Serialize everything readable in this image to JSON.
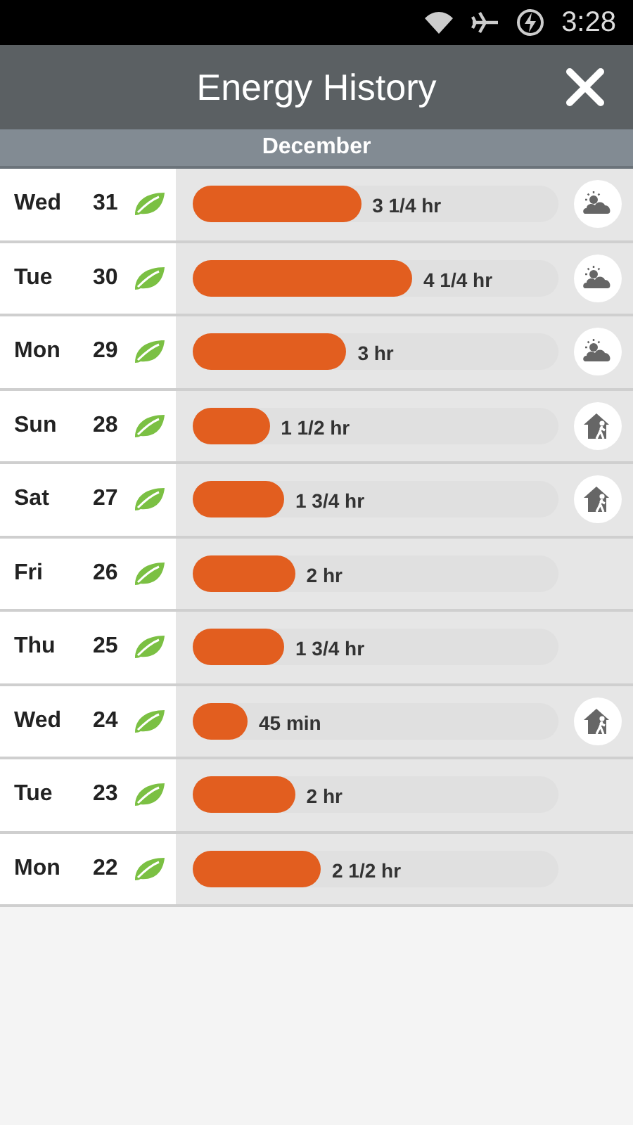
{
  "status_bar": {
    "time": "3:28"
  },
  "header": {
    "title": "Energy History"
  },
  "month": "December",
  "days": [
    {
      "weekday": "Wed",
      "date": "31",
      "leaf": true,
      "level": 0.46,
      "duration": "3 1/4 hr",
      "kind": "weather"
    },
    {
      "weekday": "Tue",
      "date": "30",
      "leaf": true,
      "level": 0.6,
      "duration": "4 1/4 hr",
      "kind": "weather"
    },
    {
      "weekday": "Mon",
      "date": "29",
      "leaf": true,
      "level": 0.42,
      "duration": "3 hr",
      "kind": "weather"
    },
    {
      "weekday": "Sun",
      "date": "28",
      "leaf": true,
      "level": 0.21,
      "duration": "1 1/2 hr",
      "kind": "away"
    },
    {
      "weekday": "Sat",
      "date": "27",
      "leaf": true,
      "level": 0.25,
      "duration": "1 3/4 hr",
      "kind": "away"
    },
    {
      "weekday": "Fri",
      "date": "26",
      "leaf": true,
      "level": 0.28,
      "duration": "2 hr",
      "kind": "none"
    },
    {
      "weekday": "Thu",
      "date": "25",
      "leaf": true,
      "level": 0.25,
      "duration": "1 3/4 hr",
      "kind": "none"
    },
    {
      "weekday": "Wed",
      "date": "24",
      "leaf": true,
      "level": 0.15,
      "duration": "45 min",
      "kind": "away"
    },
    {
      "weekday": "Tue",
      "date": "23",
      "leaf": true,
      "level": 0.28,
      "duration": "2 hr",
      "kind": "none"
    },
    {
      "weekday": "Mon",
      "date": "22",
      "leaf": true,
      "level": 0.35,
      "duration": "2 1/2 hr",
      "kind": "none"
    }
  ]
}
